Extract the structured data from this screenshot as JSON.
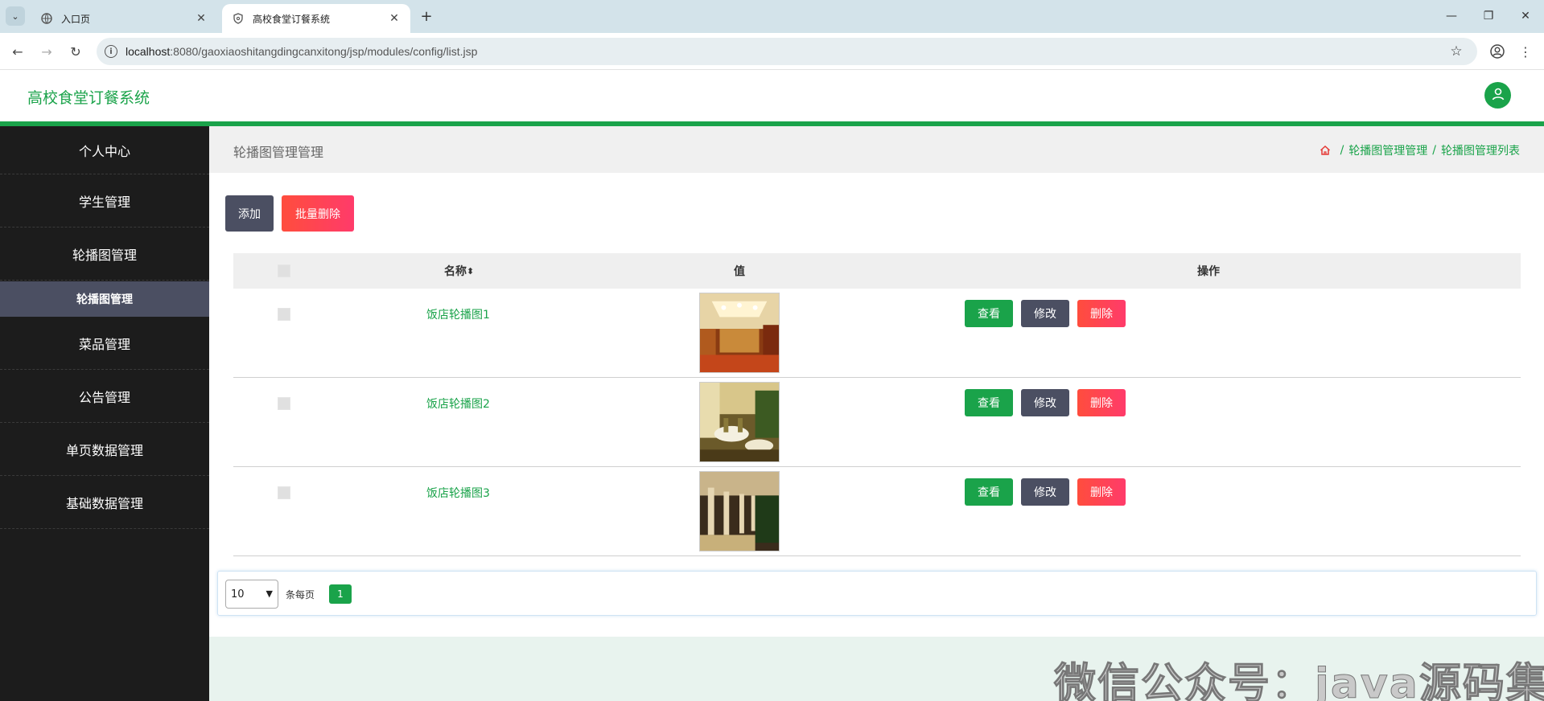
{
  "browser": {
    "tabs": [
      {
        "title": "入口页",
        "favicon": "globe-icon"
      },
      {
        "title": "高校食堂订餐系统",
        "favicon": "shield-icon"
      }
    ],
    "url_host": "localhost",
    "url_path": ":8080/gaoxiaoshitangdingcanxitong/jsp/modules/config/list.jsp"
  },
  "app": {
    "title": "高校食堂订餐系统",
    "accent": "#1aa34a"
  },
  "sidebar": {
    "items": [
      {
        "label": "个人中心"
      },
      {
        "label": "学生管理"
      },
      {
        "label": "轮播图管理"
      },
      {
        "label": "轮播图管理",
        "sub": true
      },
      {
        "label": "菜品管理"
      },
      {
        "label": "公告管理"
      },
      {
        "label": "单页数据管理"
      },
      {
        "label": "基础数据管理"
      }
    ]
  },
  "page": {
    "title": "轮播图管理管理",
    "breadcrumb": [
      "轮播图管理管理",
      "轮播图管理列表"
    ],
    "breadcrumb_sep": "/"
  },
  "toolbar": {
    "add_label": "添加",
    "batch_delete_label": "批量删除"
  },
  "table": {
    "headers": {
      "name": "名称",
      "sort_icon": "⬍",
      "value": "值",
      "ops": "操作"
    },
    "rows": [
      {
        "name": "饭店轮播图1",
        "view": "查看",
        "edit": "修改",
        "del": "删除"
      },
      {
        "name": "饭店轮播图2",
        "view": "查看",
        "edit": "修改",
        "del": "删除"
      },
      {
        "name": "饭店轮播图3",
        "view": "查看",
        "edit": "修改",
        "del": "删除"
      }
    ]
  },
  "pager": {
    "page_size": "10",
    "per_page_label": "条每页",
    "current_page": "1"
  },
  "watermark": "微信公众号：java源码集合"
}
